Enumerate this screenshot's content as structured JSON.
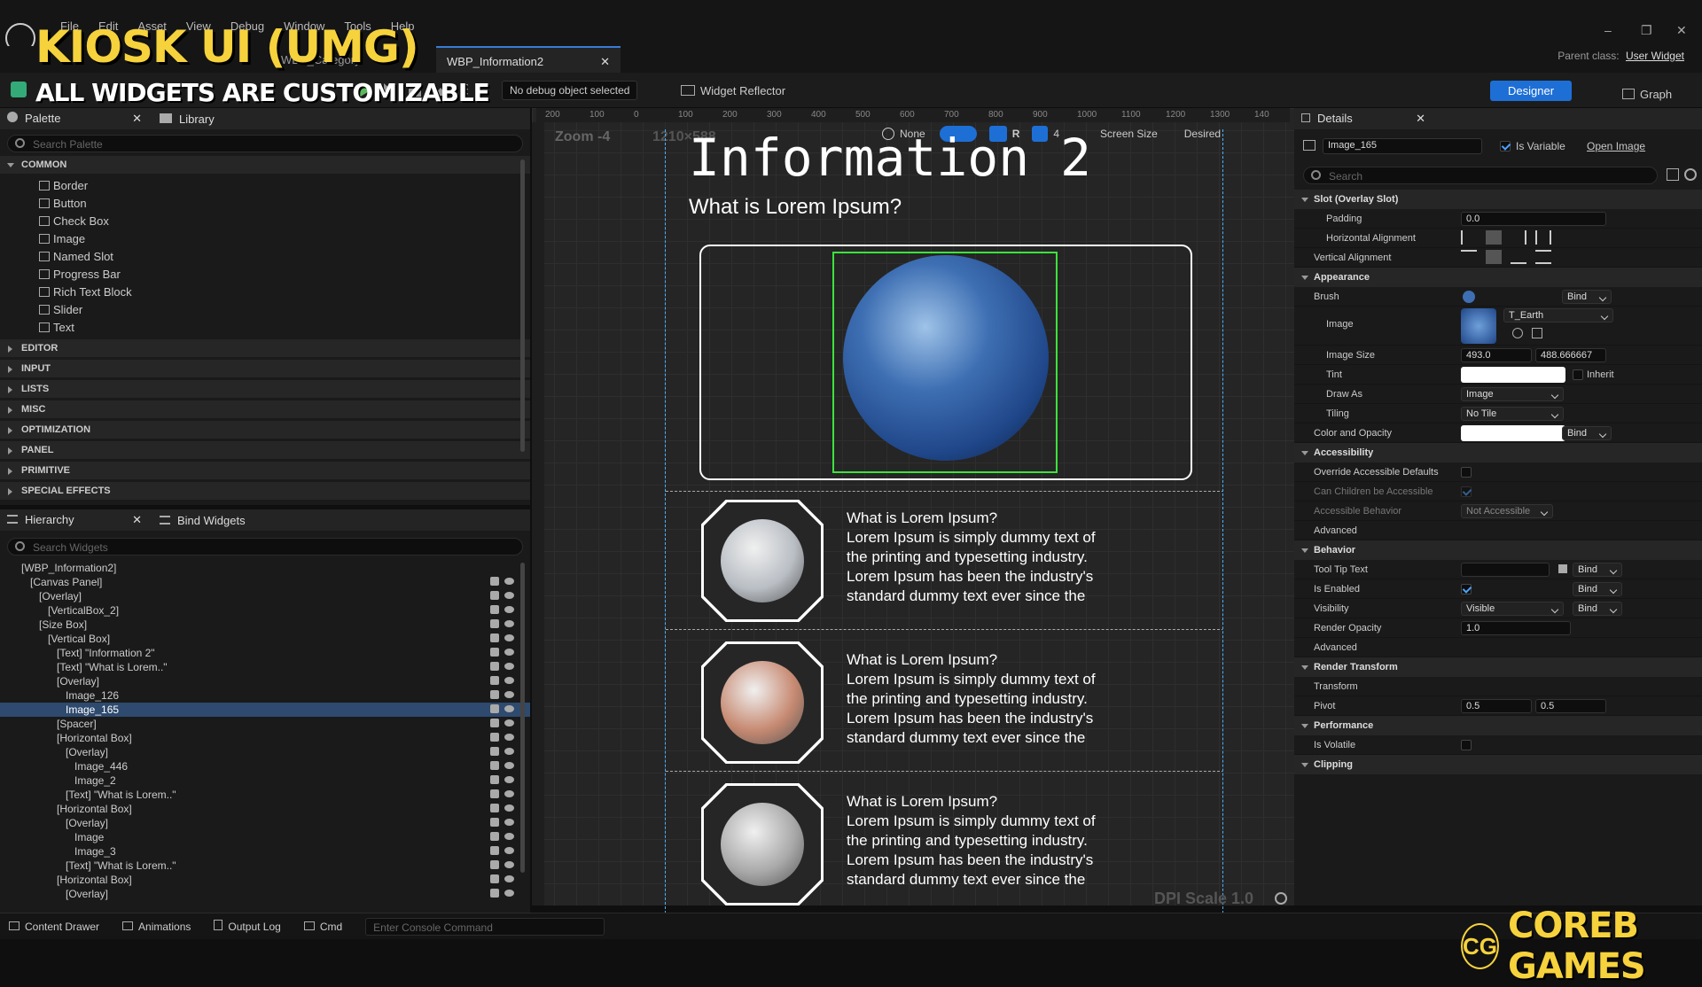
{
  "overlay": {
    "title": "KIOSK UI (UMG)",
    "subtitle": "ALL WIDGETS ARE CUSTOMIZABLE",
    "brand_initials": "CG",
    "brand_name": "COREB GAMES"
  },
  "menu": [
    "File",
    "Edit",
    "Asset",
    "View",
    "Debug",
    "Window",
    "Tools",
    "Help"
  ],
  "tabs": [
    {
      "label": "WBP_Category"
    },
    {
      "label": "WBP_Information2",
      "active": true
    }
  ],
  "parent_class_label": "Parent class:",
  "parent_class_value": "User Widget",
  "toolbar": {
    "debug_select": "No debug object selected",
    "widget_reflector": "Widget Reflector",
    "designer": "Designer",
    "graph": "Graph"
  },
  "palette": {
    "tab": "Palette",
    "library_tab": "Library",
    "search_placeholder": "Search Palette",
    "common": "COMMON",
    "items": [
      "Border",
      "Button",
      "Check Box",
      "Image",
      "Named Slot",
      "Progress Bar",
      "Rich Text Block",
      "Slider",
      "Text"
    ],
    "categories": [
      "EDITOR",
      "INPUT",
      "LISTS",
      "MISC",
      "OPTIMIZATION",
      "PANEL",
      "PRIMITIVE",
      "SPECIAL EFFECTS"
    ]
  },
  "hierarchy": {
    "tab": "Hierarchy",
    "bind_tab": "Bind Widgets",
    "search_placeholder": "Search Widgets",
    "rows": [
      {
        "label": "[WBP_Information2]",
        "indent": 0
      },
      {
        "label": "[Canvas Panel]",
        "indent": 1
      },
      {
        "label": "[Overlay]",
        "indent": 2
      },
      {
        "label": "[VerticalBox_2]",
        "indent": 3
      },
      {
        "label": "[Size Box]",
        "indent": 2
      },
      {
        "label": "[Vertical Box]",
        "indent": 3
      },
      {
        "label": "[Text] \"Information 2\"",
        "indent": 4
      },
      {
        "label": "[Text] \"What is Lorem..\"",
        "indent": 4
      },
      {
        "label": "[Overlay]",
        "indent": 4
      },
      {
        "label": "Image_126",
        "indent": 5
      },
      {
        "label": "Image_165",
        "indent": 5,
        "selected": true
      },
      {
        "label": "[Spacer]",
        "indent": 4
      },
      {
        "label": "[Horizontal Box]",
        "indent": 4
      },
      {
        "label": "[Overlay]",
        "indent": 5
      },
      {
        "label": "Image_446",
        "indent": 6
      },
      {
        "label": "Image_2",
        "indent": 6
      },
      {
        "label": "[Text] \"What is Lorem..\"",
        "indent": 5
      },
      {
        "label": "[Horizontal Box]",
        "indent": 4
      },
      {
        "label": "[Overlay]",
        "indent": 5
      },
      {
        "label": "Image",
        "indent": 6
      },
      {
        "label": "Image_3",
        "indent": 6
      },
      {
        "label": "[Text] \"What is Lorem..\"",
        "indent": 5
      },
      {
        "label": "[Horizontal Box]",
        "indent": 4
      },
      {
        "label": "[Overlay]",
        "indent": 5
      }
    ]
  },
  "viewport": {
    "zoom": "Zoom -4",
    "res": "1210×588",
    "none": "None",
    "screen_size": "Screen Size",
    "desired": "Desired",
    "grid": "4",
    "dpi": "DPI Scale 1.0",
    "ruler": [
      "200",
      "100",
      "0",
      "100",
      "200",
      "300",
      "400",
      "500",
      "600",
      "700",
      "800",
      "900",
      "1000",
      "1100",
      "1200",
      "1300",
      "140"
    ],
    "title": "Information 2",
    "subtitle": "What is Lorem Ipsum?",
    "cards": [
      {
        "heading": "What is Lorem Ipsum?",
        "body": [
          "Lorem Ipsum is simply dummy text of",
          "the printing and typesetting industry.",
          "Lorem Ipsum has been the industry's",
          "standard dummy text ever since the"
        ],
        "color": "#b9bec4"
      },
      {
        "heading": "What is Lorem Ipsum?",
        "body": [
          "Lorem Ipsum is simply dummy text of",
          "the printing and typesetting industry.",
          "Lorem Ipsum has been the industry's",
          "standard dummy text ever since the"
        ],
        "color": "#c78a72"
      },
      {
        "heading": "What is Lorem Ipsum?",
        "body": [
          "Lorem Ipsum is simply dummy text of",
          "the printing and typesetting industry.",
          "Lorem Ipsum has been the industry's",
          "standard dummy text ever since the"
        ],
        "color": "#a9a9a9"
      }
    ]
  },
  "details": {
    "tab": "Details",
    "name": "Image_165",
    "is_variable": "Is Variable",
    "open_image": "Open Image",
    "search_placeholder": "Search",
    "slot": "Slot (Overlay Slot)",
    "padding": "Padding",
    "padding_val": "0.0",
    "halign": "Horizontal Alignment",
    "valign": "Vertical Alignment",
    "appearance": "Appearance",
    "brush": "Brush",
    "bind": "Bind",
    "image": "Image",
    "texture": "T_Earth",
    "image_size": "Image Size",
    "size_x": "493.0",
    "size_y": "488.666667",
    "tint": "Tint",
    "inherit": "Inherit",
    "draw_as": "Draw As",
    "draw_as_val": "Image",
    "tiling": "Tiling",
    "tiling_val": "No Tile",
    "color_opacity": "Color and Opacity",
    "accessibility": "Accessibility",
    "override": "Override Accessible Defaults",
    "can_children": "Can Children be Accessible",
    "acc_behavior": "Accessible Behavior",
    "not_accessible": "Not Accessible",
    "advanced": "Advanced",
    "behavior": "Behavior",
    "tooltip": "Tool Tip Text",
    "is_enabled": "Is Enabled",
    "visibility": "Visibility",
    "visible": "Visible",
    "render_opacity": "Render Opacity",
    "opacity_val": "1.0",
    "render_transform": "Render Transform",
    "transform": "Transform",
    "pivot": "Pivot",
    "pivot_x": "0.5",
    "pivot_y": "0.5",
    "performance": "Performance",
    "is_volatile": "Is Volatile",
    "clipping": "Clipping"
  },
  "status": {
    "content_drawer": "Content Drawer",
    "animations": "Animations",
    "output_log": "Output Log",
    "cmd": "Cmd",
    "console_placeholder": "Enter Console Command"
  }
}
